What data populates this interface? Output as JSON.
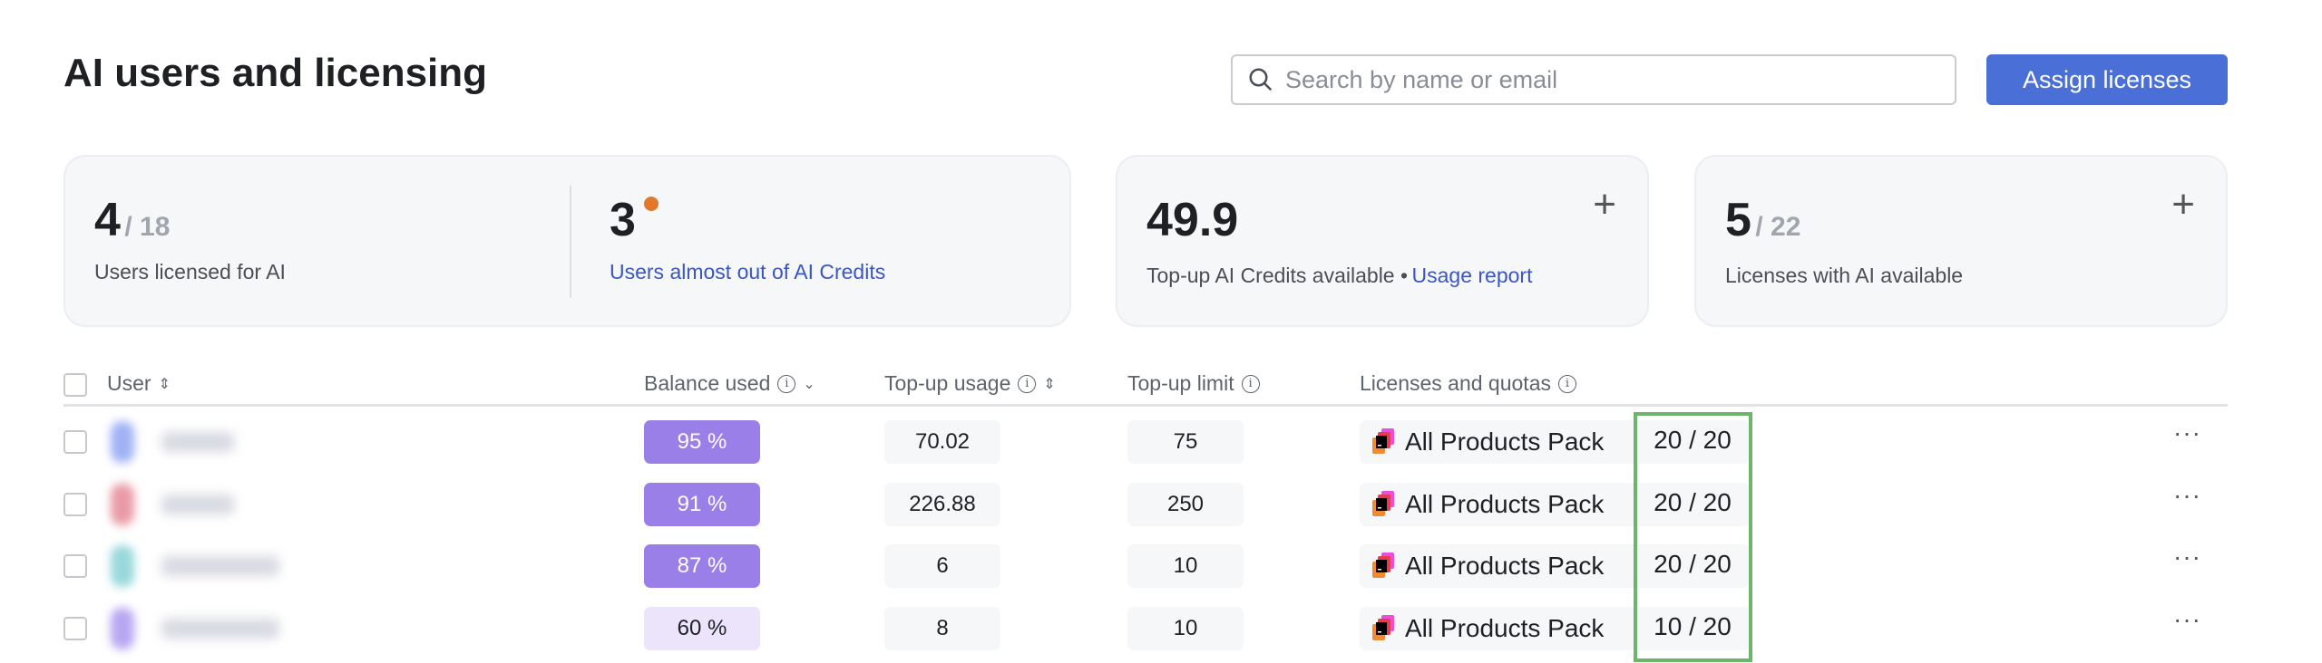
{
  "header": {
    "title": "AI users and licensing",
    "search_placeholder": "Search by name or email",
    "assign_button": "Assign licenses"
  },
  "stats": {
    "licensed": {
      "value": "4",
      "total": "/ 18",
      "label": "Users licensed for AI"
    },
    "almost_out": {
      "value": "3",
      "label": "Users almost out of AI Credits",
      "dot_color": "#e07a2a"
    },
    "topup": {
      "value": "49.9",
      "label": "Top-up AI Credits available •",
      "link": "Usage report"
    },
    "licenses": {
      "value": "5",
      "total": "/ 22",
      "label": "Licenses with AI available"
    }
  },
  "table": {
    "columns": [
      "User",
      "Balance used",
      "Top-up usage",
      "Top-up limit",
      "Licenses and quotas"
    ],
    "rows": [
      {
        "balance": "95 %",
        "topup_usage": "70.02",
        "topup_limit": "75",
        "license": "All Products Pack",
        "quota": "20 / 20",
        "avatar": "#9fb2f5",
        "high": true
      },
      {
        "balance": "91 %",
        "topup_usage": "226.88",
        "topup_limit": "250",
        "license": "All Products Pack",
        "quota": "20 / 20",
        "avatar": "#e99aa6",
        "high": true
      },
      {
        "balance": "87 %",
        "topup_usage": "6",
        "topup_limit": "10",
        "license": "All Products Pack",
        "quota": "20 / 20",
        "avatar": "#98d8dc",
        "high": true
      },
      {
        "balance": "60 %",
        "topup_usage": "8",
        "topup_limit": "10",
        "license": "All Products Pack",
        "quota": "10 / 20",
        "avatar": "#b7a6f2",
        "high": false
      }
    ]
  }
}
